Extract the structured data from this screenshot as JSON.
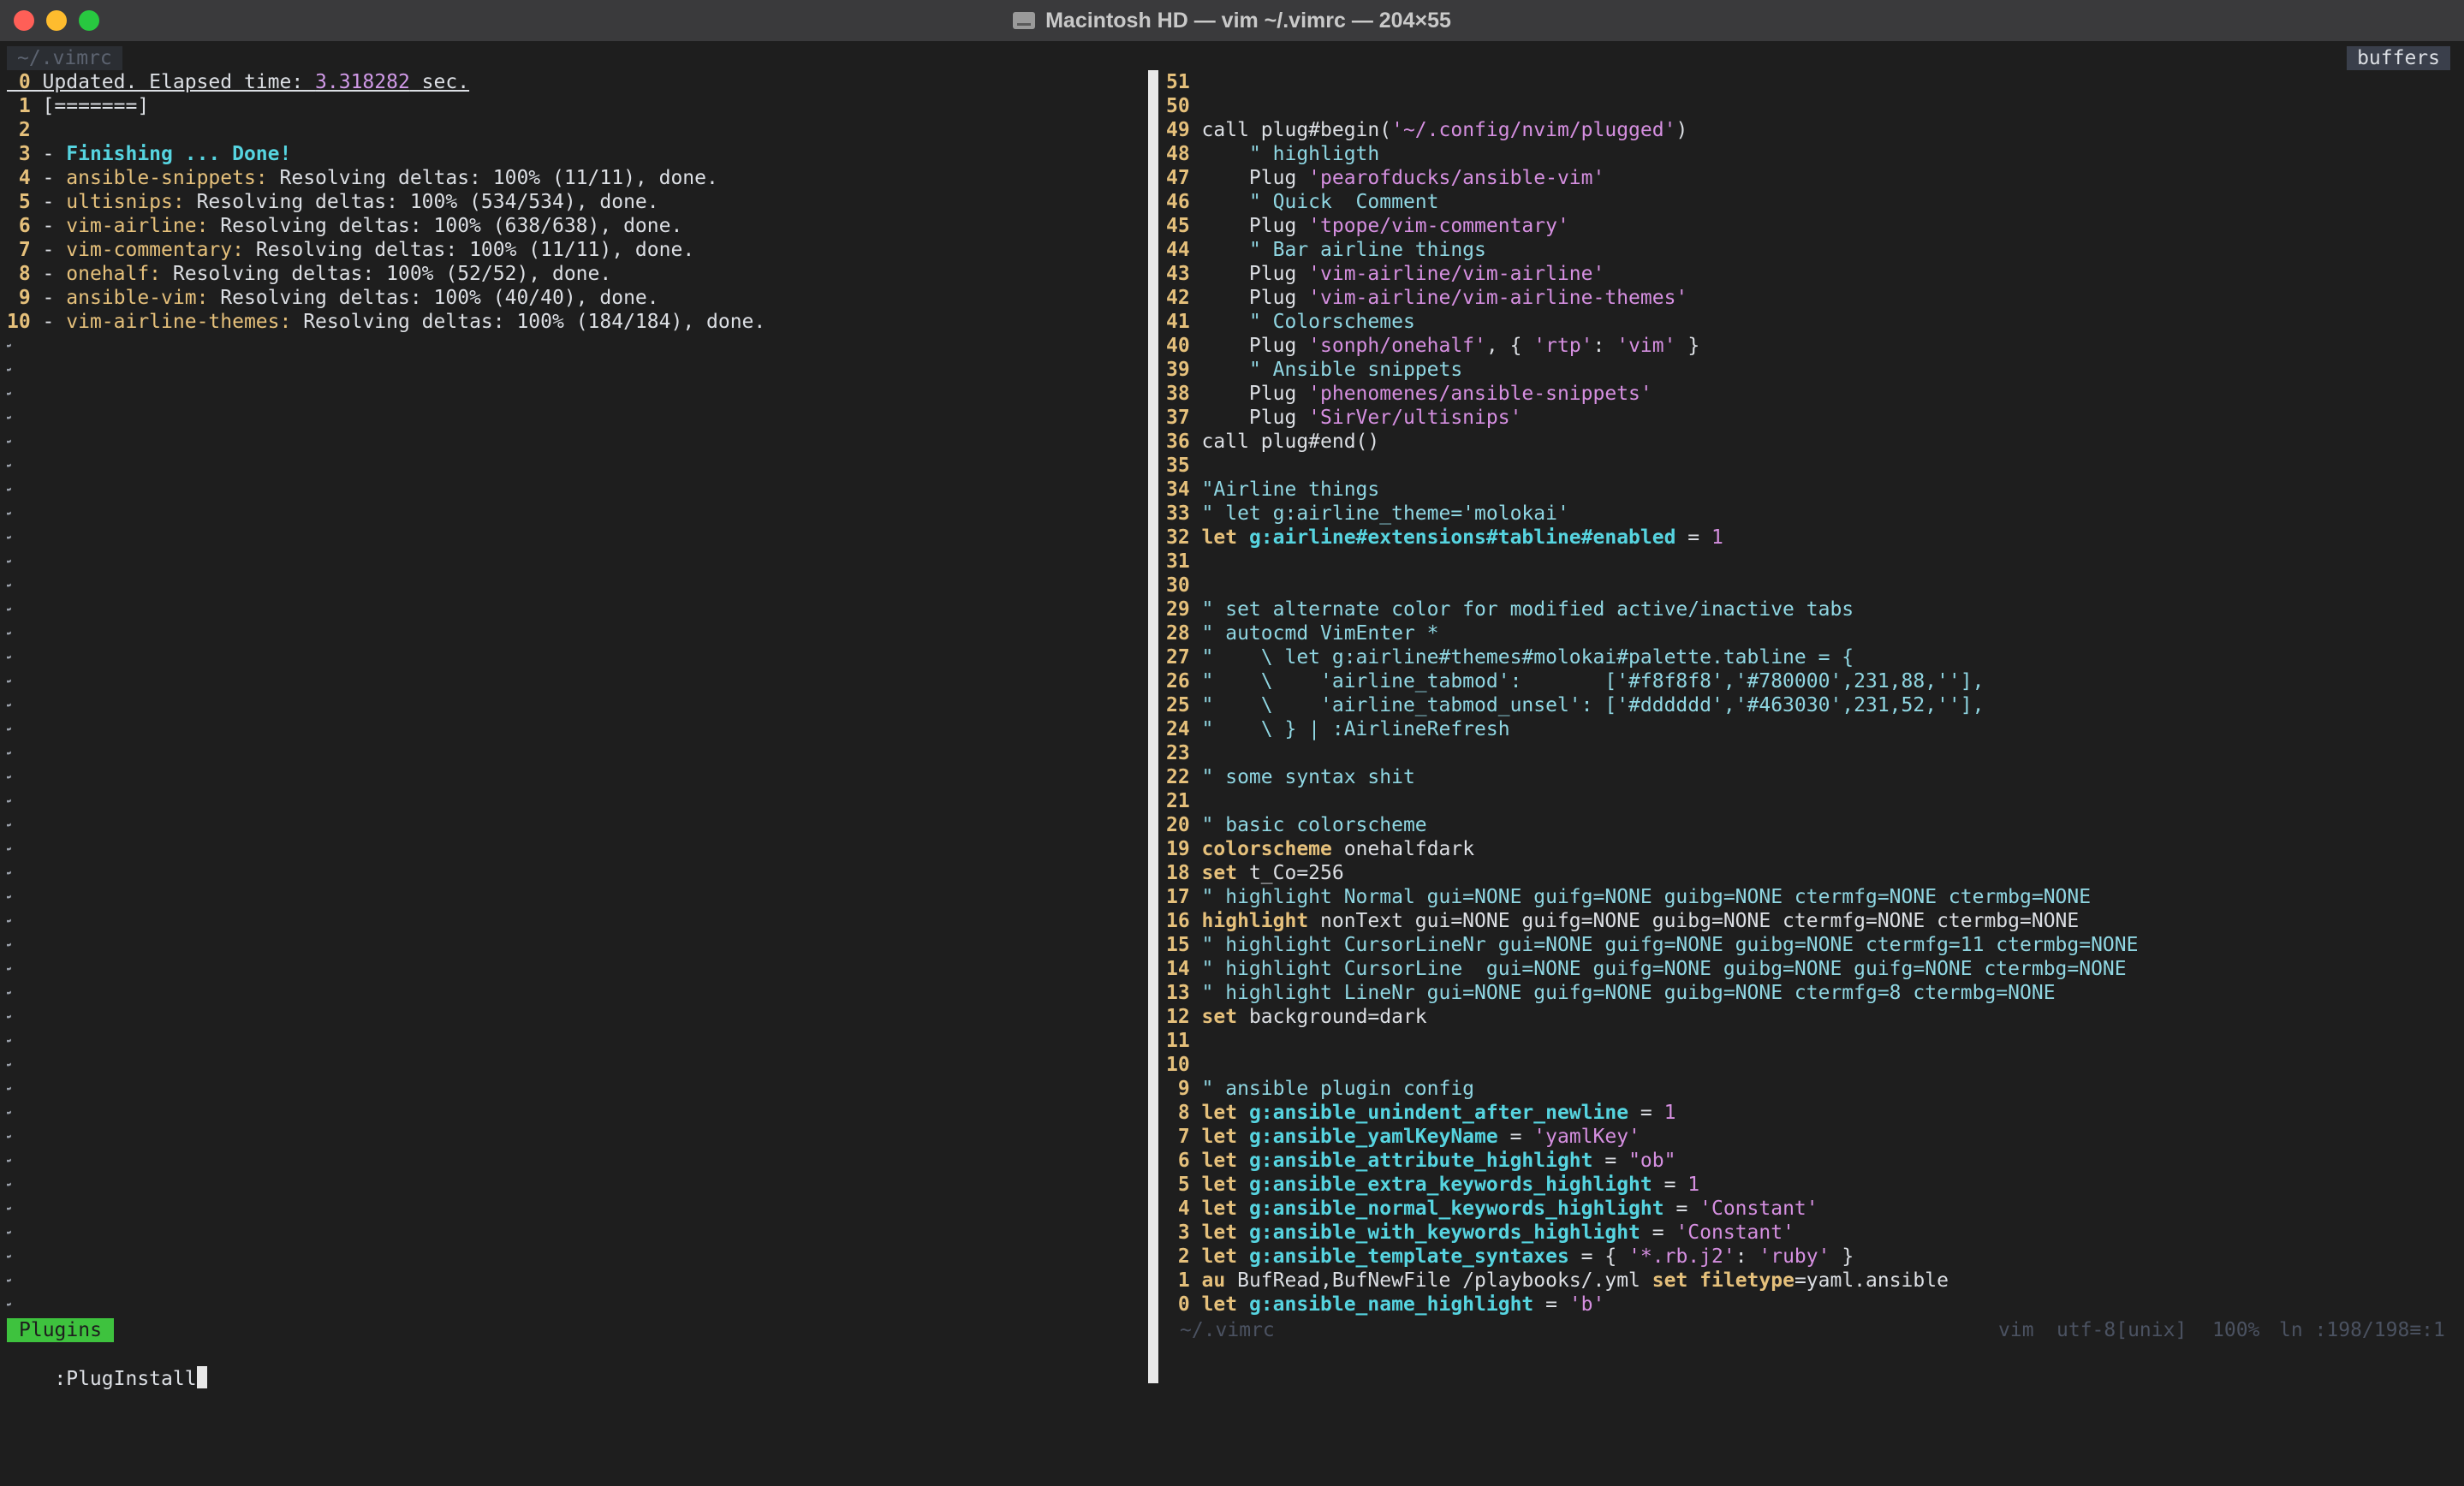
{
  "window": {
    "title": "Macintosh HD — vim ~/.vimrc — 204×55",
    "icon": "disk-icon"
  },
  "tabline": {
    "tab": "~/.vimrc",
    "buffers_label": "buffers"
  },
  "left_pane": {
    "lines": [
      {
        "nr": "0",
        "t": "Updated. Elapsed time: ",
        "t2": "3.318282",
        "t3": " sec."
      },
      {
        "nr": "1",
        "t": "[=======]"
      },
      {
        "nr": "2",
        "t": ""
      },
      {
        "nr": "3",
        "t": "Finishing ... Done!"
      },
      {
        "nr": "4",
        "p": "ansible-snippets:",
        "t": " Resolving deltas: 100% (11/11), done."
      },
      {
        "nr": "5",
        "p": "ultisnips:",
        "t": " Resolving deltas: 100% (534/534), done."
      },
      {
        "nr": "6",
        "p": "vim-airline:",
        "t": " Resolving deltas: 100% (638/638), done."
      },
      {
        "nr": "7",
        "p": "vim-commentary:",
        "t": " Resolving deltas: 100% (11/11), done."
      },
      {
        "nr": "8",
        "p": "onehalf:",
        "t": " Resolving deltas: 100% (52/52), done."
      },
      {
        "nr": "9",
        "p": "ansible-vim:",
        "t": " Resolving deltas: 100% (40/40), done."
      },
      {
        "nr": "10",
        "p": "vim-airline-themes:",
        "t": " Resolving deltas: 100% (184/184), done."
      }
    ],
    "tilde_count": 41,
    "tilde": "~",
    "dash": "-"
  },
  "right_pane": {
    "lines": [
      {
        "nr": "51",
        "segs": []
      },
      {
        "nr": "50",
        "segs": []
      },
      {
        "nr": "49",
        "segs": [
          [
            "p",
            "call plug#begin("
          ],
          [
            "s",
            "'~/.config/nvim/plugged'"
          ],
          [
            "p",
            ")"
          ]
        ]
      },
      {
        "nr": "48",
        "segs": [
          [
            "p",
            "    "
          ],
          [
            "c",
            "\" highligth"
          ]
        ]
      },
      {
        "nr": "47",
        "segs": [
          [
            "p",
            "    Plug "
          ],
          [
            "s",
            "'pearofducks/ansible-vim'"
          ]
        ]
      },
      {
        "nr": "46",
        "segs": [
          [
            "p",
            "    "
          ],
          [
            "c",
            "\" Quick  Comment"
          ]
        ]
      },
      {
        "nr": "45",
        "segs": [
          [
            "p",
            "    Plug "
          ],
          [
            "s",
            "'tpope/vim-commentary'"
          ]
        ]
      },
      {
        "nr": "44",
        "segs": [
          [
            "p",
            "    "
          ],
          [
            "c",
            "\" Bar airline things"
          ]
        ]
      },
      {
        "nr": "43",
        "segs": [
          [
            "p",
            "    Plug "
          ],
          [
            "s",
            "'vim-airline/vim-airline'"
          ]
        ]
      },
      {
        "nr": "42",
        "segs": [
          [
            "p",
            "    Plug "
          ],
          [
            "s",
            "'vim-airline/vim-airline-themes'"
          ]
        ]
      },
      {
        "nr": "41",
        "segs": [
          [
            "p",
            "    "
          ],
          [
            "c",
            "\" Colorschemes"
          ]
        ]
      },
      {
        "nr": "40",
        "segs": [
          [
            "p",
            "    Plug "
          ],
          [
            "s",
            "'sonph/onehalf'"
          ],
          [
            "p",
            ", { "
          ],
          [
            "s",
            "'rtp'"
          ],
          [
            "p",
            ": "
          ],
          [
            "s",
            "'vim'"
          ],
          [
            "p",
            " }"
          ]
        ]
      },
      {
        "nr": "39",
        "segs": [
          [
            "p",
            "    "
          ],
          [
            "c",
            "\" Ansible snippets"
          ]
        ]
      },
      {
        "nr": "38",
        "segs": [
          [
            "p",
            "    Plug "
          ],
          [
            "s",
            "'phenomenes/ansible-snippets'"
          ]
        ]
      },
      {
        "nr": "37",
        "segs": [
          [
            "p",
            "    Plug "
          ],
          [
            "s",
            "'SirVer/ultisnips'"
          ]
        ]
      },
      {
        "nr": "36",
        "segs": [
          [
            "p",
            "call plug#end()"
          ]
        ]
      },
      {
        "nr": "35",
        "segs": []
      },
      {
        "nr": "34",
        "segs": [
          [
            "c",
            "\"Airline things"
          ]
        ]
      },
      {
        "nr": "33",
        "segs": [
          [
            "c",
            "\" let g:airline_theme='molokai'"
          ]
        ]
      },
      {
        "nr": "32",
        "segs": [
          [
            "y",
            "let "
          ],
          [
            "v",
            "g:airline#extensions#tabline#enabled"
          ],
          [
            "p",
            " = "
          ],
          [
            "n",
            "1"
          ]
        ]
      },
      {
        "nr": "31",
        "segs": []
      },
      {
        "nr": "30",
        "segs": []
      },
      {
        "nr": "29",
        "segs": [
          [
            "c",
            "\" set alternate color for modified active/inactive tabs"
          ]
        ]
      },
      {
        "nr": "28",
        "segs": [
          [
            "c",
            "\" autocmd VimEnter *"
          ]
        ]
      },
      {
        "nr": "27",
        "segs": [
          [
            "c",
            "\"    \\ let g:airline#themes#molokai#palette.tabline = {"
          ]
        ]
      },
      {
        "nr": "26",
        "segs": [
          [
            "c",
            "\"    \\    'airline_tabmod':       ['#f8f8f8','#780000',231,88,''],"
          ]
        ]
      },
      {
        "nr": "25",
        "segs": [
          [
            "c",
            "\"    \\    'airline_tabmod_unsel': ['#dddddd','#463030',231,52,''],"
          ]
        ]
      },
      {
        "nr": "24",
        "segs": [
          [
            "c",
            "\"    \\ } | :AirlineRefresh"
          ]
        ]
      },
      {
        "nr": "23",
        "segs": []
      },
      {
        "nr": "22",
        "segs": [
          [
            "c",
            "\" some syntax shit"
          ]
        ]
      },
      {
        "nr": "21",
        "segs": []
      },
      {
        "nr": "20",
        "segs": [
          [
            "c",
            "\" basic colorscheme"
          ]
        ]
      },
      {
        "nr": "19",
        "segs": [
          [
            "y",
            "colorscheme"
          ],
          [
            "p",
            " onehalfdark"
          ]
        ]
      },
      {
        "nr": "18",
        "segs": [
          [
            "y",
            "set"
          ],
          [
            "p",
            " t_Co=256"
          ]
        ]
      },
      {
        "nr": "17",
        "segs": [
          [
            "c",
            "\" highlight Normal gui=NONE guifg=NONE guibg=NONE ctermfg=NONE ctermbg=NONE"
          ]
        ]
      },
      {
        "nr": "16",
        "segs": [
          [
            "y",
            "highlight"
          ],
          [
            "p",
            " nonText gui=NONE guifg=NONE guibg=NONE ctermfg=NONE ctermbg=NONE"
          ]
        ]
      },
      {
        "nr": "15",
        "segs": [
          [
            "c",
            "\" highlight CursorLineNr gui=NONE guifg=NONE guibg=NONE ctermfg=11 ctermbg=NONE"
          ]
        ]
      },
      {
        "nr": "14",
        "segs": [
          [
            "c",
            "\" highlight CursorLine  gui=NONE guifg=NONE guibg=NONE guifg=NONE ctermbg=NONE"
          ]
        ]
      },
      {
        "nr": "13",
        "segs": [
          [
            "c",
            "\" highlight LineNr gui=NONE guifg=NONE guibg=NONE ctermfg=8 ctermbg=NONE"
          ]
        ]
      },
      {
        "nr": "12",
        "segs": [
          [
            "y",
            "set"
          ],
          [
            "p",
            " background=dark"
          ]
        ]
      },
      {
        "nr": "11",
        "segs": []
      },
      {
        "nr": "10",
        "segs": []
      },
      {
        "nr": "9",
        "segs": [
          [
            "c",
            "\" ansible plugin config"
          ]
        ]
      },
      {
        "nr": "8",
        "segs": [
          [
            "y",
            "let "
          ],
          [
            "v",
            "g:ansible_unindent_after_newline"
          ],
          [
            "p",
            " = "
          ],
          [
            "n",
            "1"
          ]
        ]
      },
      {
        "nr": "7",
        "segs": [
          [
            "y",
            "let "
          ],
          [
            "v",
            "g:ansible_yamlKeyName"
          ],
          [
            "p",
            " = "
          ],
          [
            "s",
            "'yamlKey'"
          ]
        ]
      },
      {
        "nr": "6",
        "segs": [
          [
            "y",
            "let "
          ],
          [
            "v",
            "g:ansible_attribute_highlight"
          ],
          [
            "p",
            " = "
          ],
          [
            "s",
            "\"ob\""
          ]
        ]
      },
      {
        "nr": "5",
        "segs": [
          [
            "y",
            "let "
          ],
          [
            "v",
            "g:ansible_extra_keywords_highlight"
          ],
          [
            "p",
            " = "
          ],
          [
            "n",
            "1"
          ]
        ]
      },
      {
        "nr": "4",
        "segs": [
          [
            "y",
            "let "
          ],
          [
            "v",
            "g:ansible_normal_keywords_highlight"
          ],
          [
            "p",
            " = "
          ],
          [
            "s",
            "'Constant'"
          ]
        ]
      },
      {
        "nr": "3",
        "segs": [
          [
            "y",
            "let "
          ],
          [
            "v",
            "g:ansible_with_keywords_highlight"
          ],
          [
            "p",
            " = "
          ],
          [
            "s",
            "'Constant'"
          ]
        ]
      },
      {
        "nr": "2",
        "segs": [
          [
            "y",
            "let "
          ],
          [
            "v",
            "g:ansible_template_syntaxes"
          ],
          [
            "p",
            " = { "
          ],
          [
            "s",
            "'*.rb.j2'"
          ],
          [
            "p",
            ": "
          ],
          [
            "s",
            "'ruby'"
          ],
          [
            "p",
            " }"
          ]
        ]
      },
      {
        "nr": "1",
        "segs": [
          [
            "y",
            "au"
          ],
          [
            "p",
            " BufRead,BufNewFile /playbooks/.yml "
          ],
          [
            "y",
            "set"
          ],
          [
            "p",
            " "
          ],
          [
            "y",
            "filetype"
          ],
          [
            "p",
            "=yaml.ansible"
          ]
        ]
      },
      {
        "nr": "0",
        "segs": [
          [
            "y",
            "let "
          ],
          [
            "v",
            "g:ansible_name_highlight"
          ],
          [
            "p",
            " = "
          ],
          [
            "s",
            "'b'"
          ]
        ]
      }
    ]
  },
  "statusline": {
    "left_mode": "Plugins",
    "right_file": "~/.vimrc",
    "right_filetype": "vim",
    "right_encoding": "utf-8[unix]",
    "right_percent": "100%",
    "right_position": "ln :198/198≡:1"
  },
  "cmdline": {
    "text": ":PlugInstall"
  },
  "colors": {
    "background": "#1e1e1e",
    "line_number": "#e5c07b",
    "string": "#d58fe0",
    "comment": "#8fd6e2",
    "variable": "#56d4e0",
    "mode_green": "#3ec23e"
  }
}
